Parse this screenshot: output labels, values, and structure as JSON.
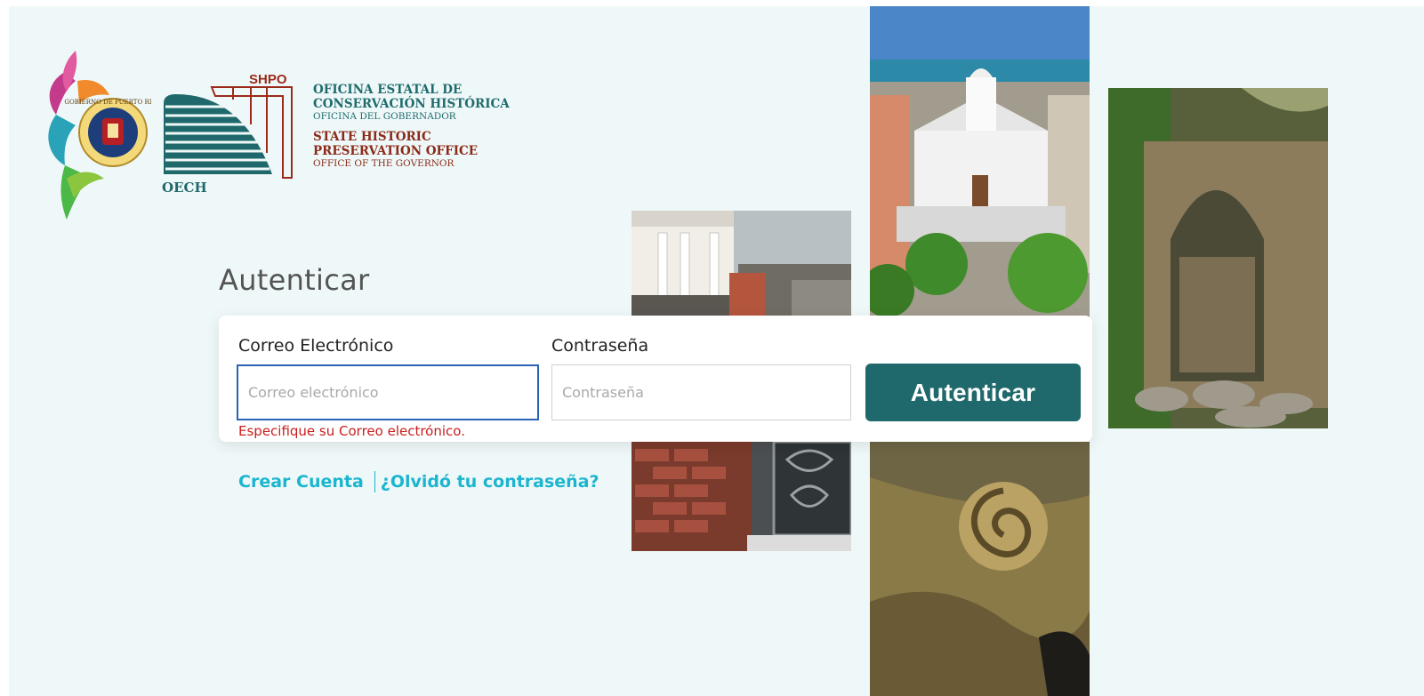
{
  "header": {
    "org_es_line1": "OFICINA ESTATAL DE",
    "org_es_line2": "CONSERVACIÓN HISTÓRICA",
    "org_es_line3": "OFICINA DEL GOBERNADOR",
    "org_en_line1": "STATE HISTORIC",
    "org_en_line2": "PRESERVATION OFFICE",
    "org_en_line3": "OFFICE OF THE GOVERNOR",
    "shpo_label": "SHPO",
    "oech_label": "OECH",
    "seal_text": "GOBIERNO DE PUERTO RICO"
  },
  "login": {
    "title": "Autenticar",
    "email_label": "Correo Electrónico",
    "email_placeholder": "Correo electrónico",
    "email_value": "",
    "password_label": "Contraseña",
    "password_placeholder": "Contraseña",
    "password_value": "",
    "error_message": "Especifique su Correo electrónico.",
    "submit_label": "Autenticar"
  },
  "links": {
    "create_account": "Crear Cuenta",
    "forgot_password": "¿Olvidó tu contraseña?"
  },
  "colors": {
    "background": "#eff8f8",
    "accent": "#1f686b",
    "link": "#1cb5cf",
    "error": "#c81e1e",
    "focus_border": "#2c63b4"
  }
}
